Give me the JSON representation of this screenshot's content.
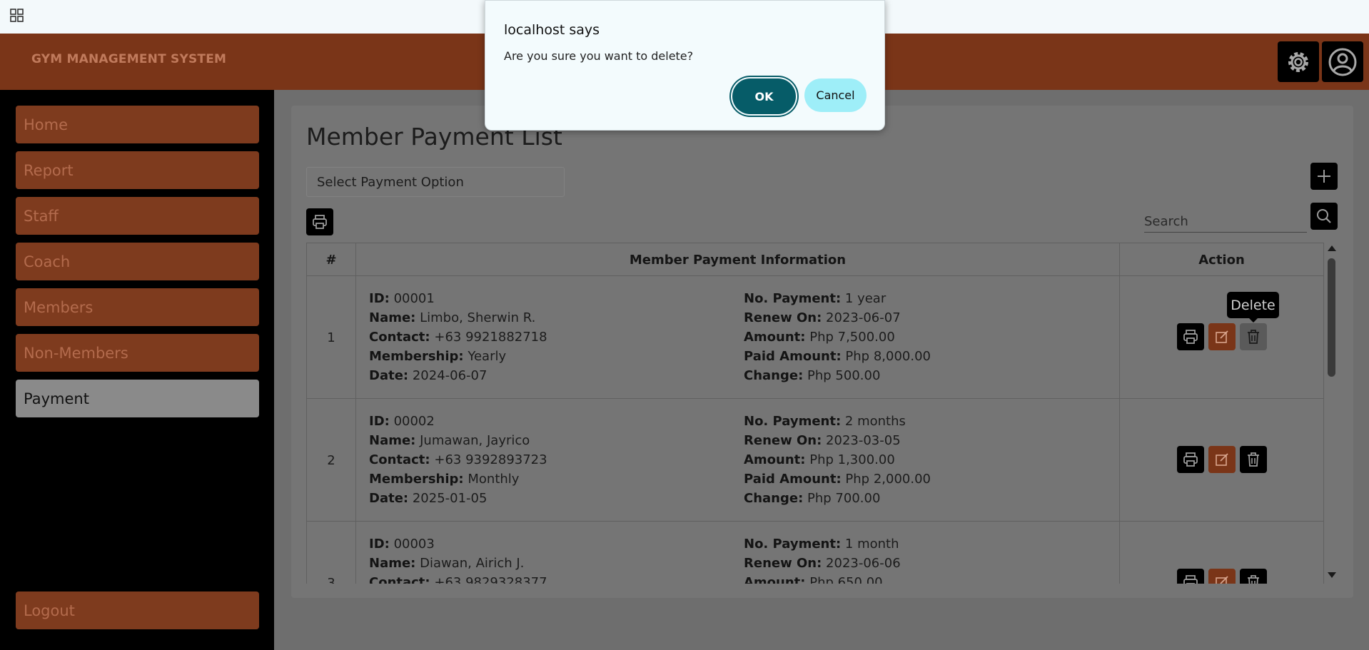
{
  "app": {
    "title": "GYM MANAGEMENT SYSTEM"
  },
  "sidebar": {
    "items": [
      {
        "label": "Home"
      },
      {
        "label": "Report"
      },
      {
        "label": "Staff"
      },
      {
        "label": "Coach"
      },
      {
        "label": "Members"
      },
      {
        "label": "Non-Members"
      },
      {
        "label": "Payment",
        "active": true
      }
    ],
    "logout_label": "Logout"
  },
  "page": {
    "title": "Member Payment List",
    "payment_select": "Select Payment Option",
    "search_placeholder": "Search"
  },
  "table": {
    "headers": [
      "#",
      "Member Payment Information",
      "Action"
    ],
    "rows": [
      {
        "num": "1",
        "id": "00001",
        "name": "Limbo, Sherwin R.",
        "contact": "+63 9921882718",
        "membership": "Yearly",
        "date": "2024-06-07",
        "no_payment": "1 year",
        "renew_on": "2023-06-07",
        "amount": "Php 7,500.00",
        "paid_amount": "Php 8,000.00",
        "change": "Php 500.00"
      },
      {
        "num": "2",
        "id": "00002",
        "name": "Jumawan, Jayrico",
        "contact": "+63 9392893723",
        "membership": "Monthly",
        "date": "2025-01-05",
        "no_payment": "2 months",
        "renew_on": "2023-03-05",
        "amount": "Php 1,300.00",
        "paid_amount": "Php 2,000.00",
        "change": "Php 700.00"
      },
      {
        "num": "3",
        "id": "00003",
        "name": "Diawan, Airich J.",
        "contact": "+63 9829328377",
        "membership": "",
        "date": "",
        "no_payment": "1 month",
        "renew_on": "2023-06-06",
        "amount": "Php 650.00",
        "paid_amount": "",
        "change": ""
      }
    ],
    "field_labels": {
      "id": "ID:",
      "name": "Name:",
      "contact": "Contact:",
      "membership": "Membership:",
      "date": "Date:",
      "no_payment": "No. Payment:",
      "renew_on": "Renew On:",
      "amount": "Amount:",
      "paid_amount": "Paid Amount:",
      "change": "Change:"
    }
  },
  "tooltip": "Delete",
  "dialog": {
    "title": "localhost says",
    "message": "Are you sure you want to delete?",
    "ok_label": "OK",
    "cancel_label": "Cancel"
  },
  "icons": [
    "apps-grid-icon",
    "gear-icon",
    "user-circle-icon",
    "printer-icon",
    "plus-icon",
    "search-icon",
    "edit-icon",
    "trash-icon"
  ],
  "colors": {
    "header": "#7a3518",
    "nav_item": "#7e3b1e",
    "dialog_ok": "#065c68",
    "dialog_cancel": "#9eeef8"
  }
}
